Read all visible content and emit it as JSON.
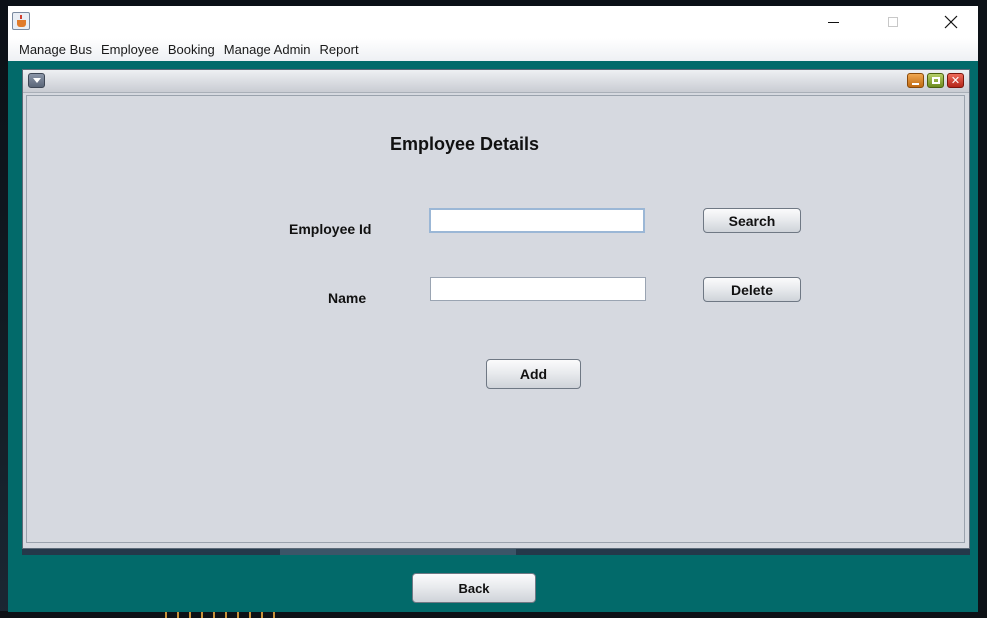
{
  "window": {
    "title": "",
    "controls": {
      "minimize": "",
      "maximize": "",
      "close": "✕"
    }
  },
  "menubar": {
    "items": [
      {
        "label": "Manage Bus"
      },
      {
        "label": "Employee"
      },
      {
        "label": "Booking"
      },
      {
        "label": "Manage Admin"
      },
      {
        "label": "Report"
      }
    ]
  },
  "internal_frame": {
    "title": "",
    "close_glyph": "✕"
  },
  "form": {
    "title": "Employee Details",
    "employee_id_label": "Employee Id",
    "employee_id_value": "",
    "name_label": "Name",
    "name_value": "",
    "search_label": "Search",
    "delete_label": "Delete",
    "add_label": "Add"
  },
  "footer": {
    "back_label": "Back"
  },
  "colors": {
    "desktop_pane": "#026a6a",
    "frame_background": "#d6d9e0"
  },
  "icons": {
    "app": "java-cup-icon",
    "frame_menu": "chevron-down-icon",
    "frame_minimize": "minimize-icon",
    "frame_maximize": "maximize-icon",
    "frame_close": "close-icon"
  }
}
